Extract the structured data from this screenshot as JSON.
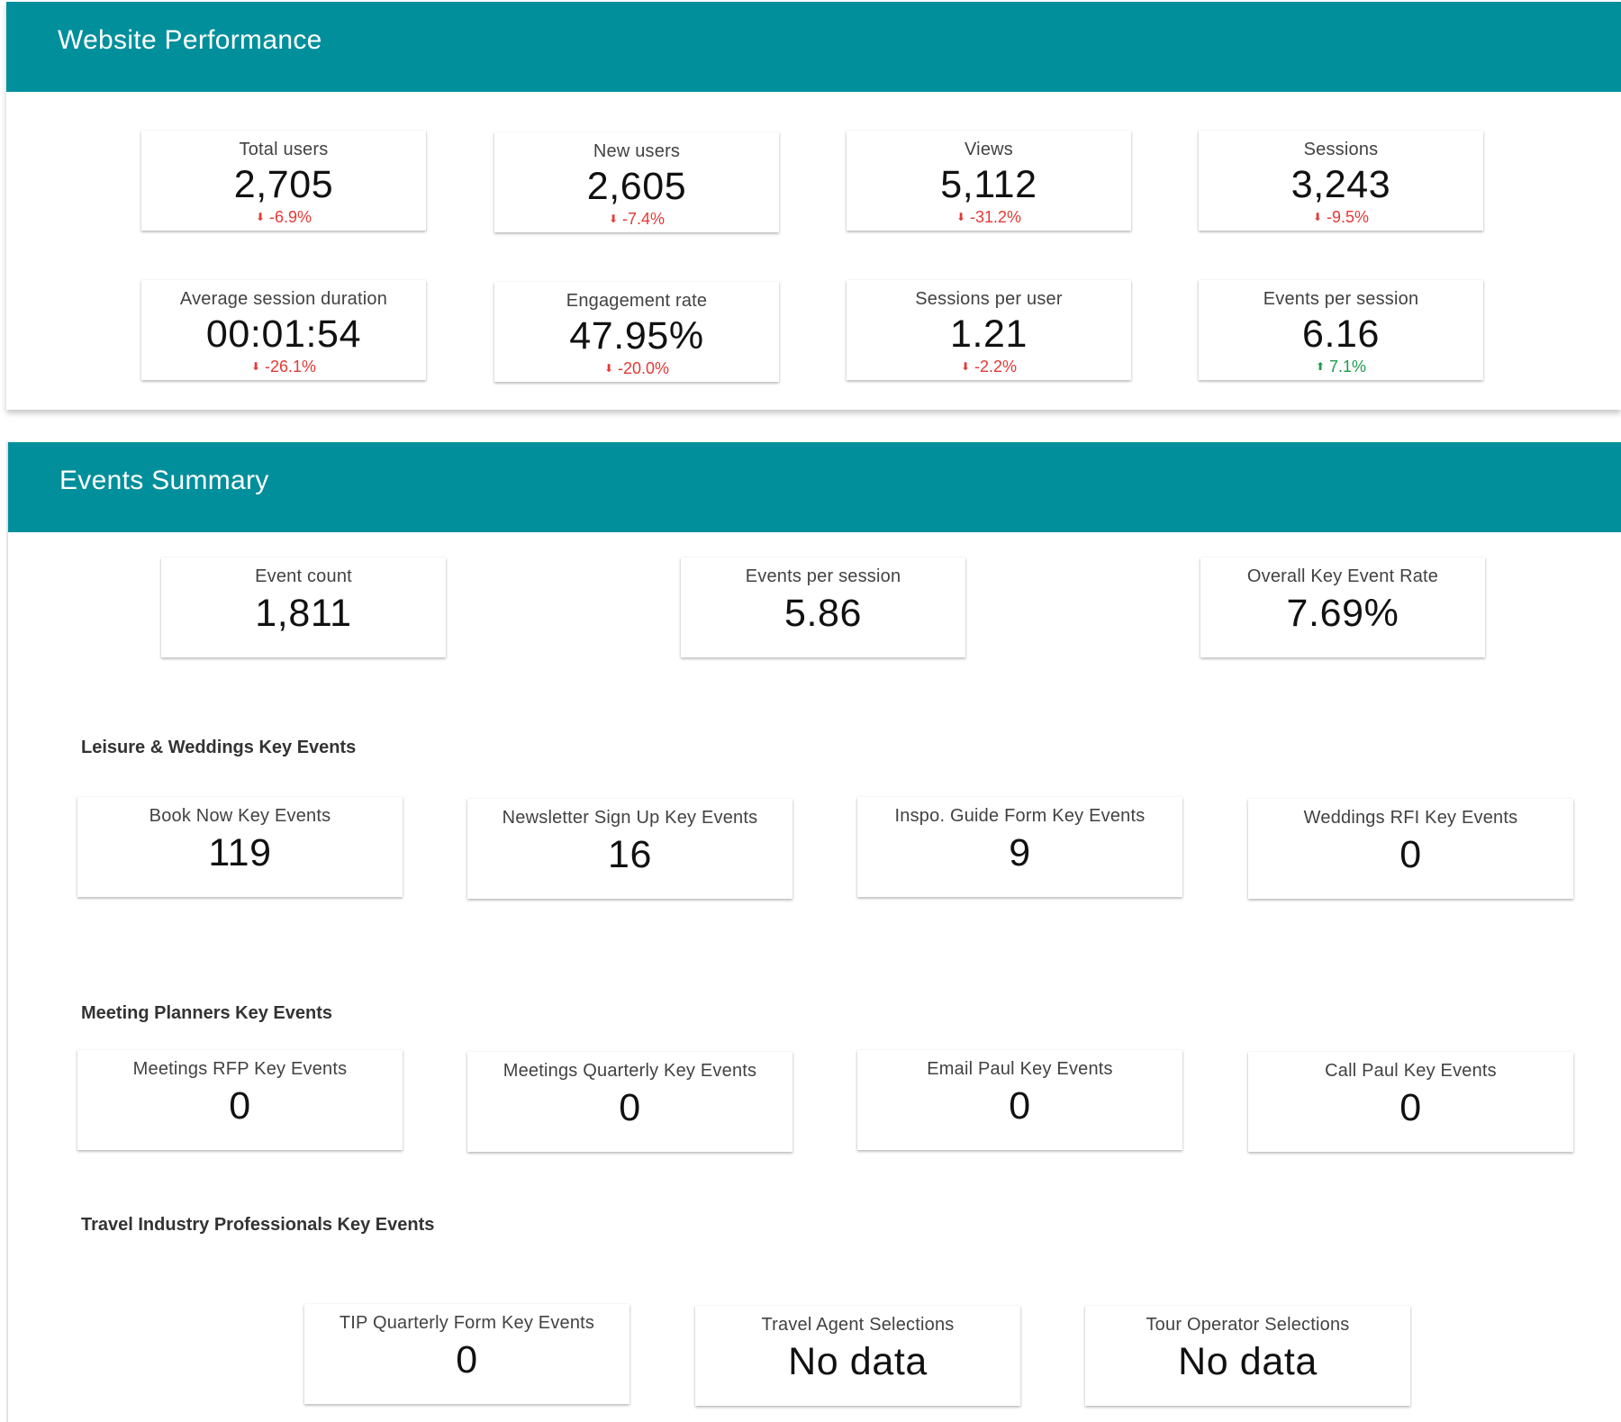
{
  "website_performance": {
    "title": "Website Performance",
    "metrics": [
      {
        "label": "Total users",
        "value": "2,705",
        "delta": "-6.9%",
        "direction": "down"
      },
      {
        "label": "New users",
        "value": "2,605",
        "delta": "-7.4%",
        "direction": "down"
      },
      {
        "label": "Views",
        "value": "5,112",
        "delta": "-31.2%",
        "direction": "down"
      },
      {
        "label": "Sessions",
        "value": "3,243",
        "delta": "-9.5%",
        "direction": "down"
      },
      {
        "label": "Average session duration",
        "value": "00:01:54",
        "delta": "-26.1%",
        "direction": "down"
      },
      {
        "label": "Engagement rate",
        "value": "47.95%",
        "delta": "-20.0%",
        "direction": "down"
      },
      {
        "label": "Sessions per user",
        "value": "1.21",
        "delta": "-2.2%",
        "direction": "down"
      },
      {
        "label": "Events per session",
        "value": "6.16",
        "delta": "7.1%",
        "direction": "up"
      }
    ]
  },
  "events_summary": {
    "title": "Events Summary",
    "overview": [
      {
        "label": "Event count",
        "value": "1,811"
      },
      {
        "label": "Events per session",
        "value": "5.86"
      },
      {
        "label": "Overall Key Event Rate",
        "value": "7.69%"
      }
    ],
    "groups": [
      {
        "title": "Leisure & Weddings Key Events",
        "metrics": [
          {
            "label": "Book Now Key Events",
            "value": "119"
          },
          {
            "label": "Newsletter Sign Up Key Events",
            "value": "16"
          },
          {
            "label": "Inspo. Guide Form Key Events",
            "value": "9"
          },
          {
            "label": "Weddings RFI Key Events",
            "value": "0"
          }
        ]
      },
      {
        "title": "Meeting Planners Key Events",
        "metrics": [
          {
            "label": "Meetings RFP Key Events",
            "value": "0"
          },
          {
            "label": "Meetings Quarterly Key Events",
            "value": "0"
          },
          {
            "label": "Email Paul Key Events",
            "value": "0"
          },
          {
            "label": "Call Paul Key Events",
            "value": "0"
          }
        ]
      },
      {
        "title": "Travel Industry Professionals Key Events",
        "metrics": [
          {
            "label": "TIP Quarterly Form Key Events",
            "value": "0"
          },
          {
            "label": "Travel Agent Selections",
            "value": "No data"
          },
          {
            "label": "Tour Operator Selections",
            "value": "No data"
          }
        ]
      }
    ]
  },
  "icons": {
    "down": "arrow-down-icon",
    "up": "arrow-up-icon"
  },
  "colors": {
    "header": "#018f9c",
    "negative": "#e53935",
    "positive": "#1e9b4a"
  }
}
